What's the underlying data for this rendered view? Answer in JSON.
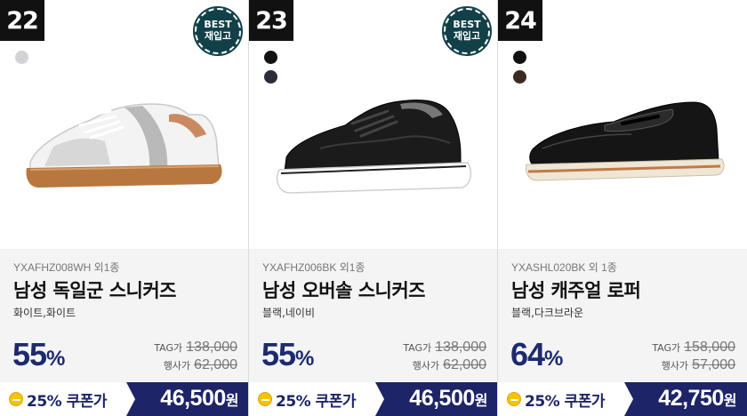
{
  "products": [
    {
      "rank": "22",
      "best_badge": {
        "line1": "BEST",
        "line2": "재입고"
      },
      "swatch_colors": [
        "#d2d2d7"
      ],
      "shoe_icon": "white-sneaker-icon",
      "code": "YXAFHZ008WH 외1종",
      "name": "남성 독일군 스니커즈",
      "colors": "화이트,화이트",
      "discount": "55",
      "discount_unit": "%",
      "tag_label": "TAG가",
      "tag_price": "138,000",
      "sale_label": "행사가",
      "sale_price": "62,000",
      "coupon_label": "25% 쿠폰가",
      "final_price": "46,500",
      "final_unit": "원"
    },
    {
      "rank": "23",
      "best_badge": {
        "line1": "BEST",
        "line2": "재입고"
      },
      "swatch_colors": [
        "#111111",
        "#2b2e3a"
      ],
      "shoe_icon": "black-sneaker-icon",
      "code": "YXAFHZ006BK 외1종",
      "name": "남성 오버솔 스니커즈",
      "colors": "블랙,네이비",
      "discount": "55",
      "discount_unit": "%",
      "tag_label": "TAG가",
      "tag_price": "138,000",
      "sale_label": "행사가",
      "sale_price": "62,000",
      "coupon_label": "25% 쿠폰가",
      "final_price": "46,500",
      "final_unit": "원"
    },
    {
      "rank": "24",
      "best_badge": null,
      "swatch_colors": [
        "#111111",
        "#3a2a22"
      ],
      "shoe_icon": "black-loafer-icon",
      "code": "YXASHL020BK 외 1종",
      "name": "남성 캐주얼 로퍼",
      "colors": "블랙,다크브라운",
      "discount": "64",
      "discount_unit": "%",
      "tag_label": "TAG가",
      "tag_price": "158,000",
      "sale_label": "행사가",
      "sale_price": "57,000",
      "coupon_label": "25% 쿠폰가",
      "final_price": "42,750",
      "final_unit": "원"
    }
  ],
  "theme": {
    "navy": "#1d2467",
    "discount_color": "#1d2a6e",
    "badge_color": "#114048",
    "coin_color": "#f5c400"
  }
}
